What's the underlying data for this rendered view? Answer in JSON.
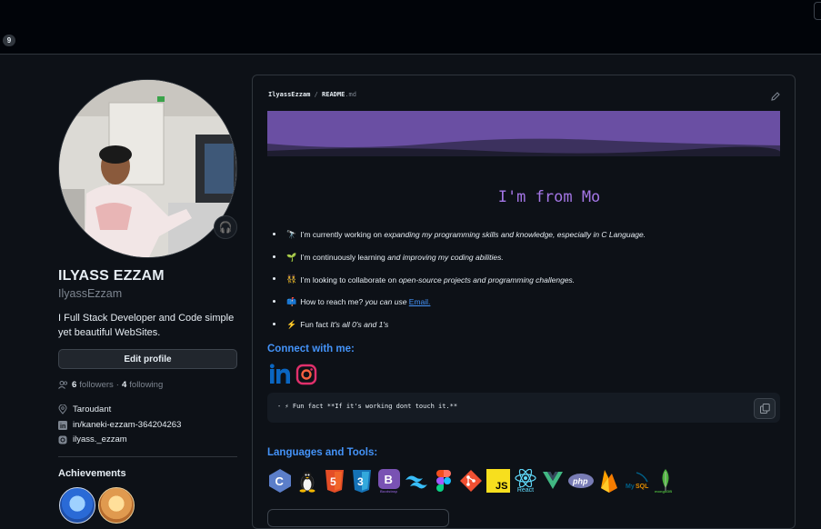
{
  "header": {
    "notification_count": "9"
  },
  "profile": {
    "status_emoji": "🎧",
    "name": "ILYASS EZZAM",
    "login": "IlyassEzzam",
    "bio": "I Full Stack Developer and Code simple yet beautiful WebSites.",
    "edit_button": "Edit profile",
    "followers_count": "6",
    "followers_label": "followers",
    "separator": "·",
    "following_count": "4",
    "following_label": "following",
    "location": "Taroudant",
    "linkedin": "in/kaneki-ezzam-364204263",
    "instagram": "ilyass._ezzam",
    "achievements_title": "Achievements"
  },
  "readme": {
    "owner": "IlyassEzzam",
    "path_sep": " / ",
    "file": "README",
    "ext": ".md",
    "heading": "I'm from Mo",
    "bullets": [
      {
        "emoji": "🔭",
        "plain": "I’m currently working on ",
        "italic": "expanding my programming skills and knowledge, especially in C Language."
      },
      {
        "emoji": "🌱",
        "plain": "I’m continuously learning ",
        "italic": "and improving my coding abilities."
      },
      {
        "emoji": "👯",
        "plain": "I’m looking to collaborate on ",
        "italic": "open-source projects and programming challenges."
      },
      {
        "emoji": "📫",
        "plain": "How to reach me? ",
        "italic": "you can use ",
        "link": "Email."
      },
      {
        "emoji": "⚡",
        "plain": "Fun fact ",
        "italic": "It's all 0's and 1's"
      }
    ],
    "connect_title": "Connect with me:",
    "code_line": "- ⚡ Fun fact **If it's working dont touch it.**",
    "languages_title": "Languages and Tools:",
    "tools": [
      {
        "name": "c",
        "label": "C",
        "color": "#5b7ec9"
      },
      {
        "name": "linux",
        "label": "🐧",
        "color": "#0d1117"
      },
      {
        "name": "html5",
        "label": "5",
        "color": "#e44d26"
      },
      {
        "name": "css3",
        "label": "3",
        "color": "#2965f1"
      },
      {
        "name": "bootstrap",
        "label": "B",
        "color": "#7952b3"
      },
      {
        "name": "tailwind",
        "label": "≈",
        "color": "#0d1117"
      },
      {
        "name": "figma",
        "label": "✦",
        "color": "#0d1117"
      },
      {
        "name": "git",
        "label": "◆",
        "color": "#f05032"
      },
      {
        "name": "javascript",
        "label": "JS",
        "color": "#f7df1e"
      },
      {
        "name": "react",
        "label": "⚛",
        "color": "#0d1117"
      },
      {
        "name": "vue",
        "label": "V",
        "color": "#0d1117"
      },
      {
        "name": "php",
        "label": "php",
        "color": "#0d1117"
      },
      {
        "name": "firebase",
        "label": "▲",
        "color": "#0d1117"
      },
      {
        "name": "mysql",
        "label": "MySQL",
        "color": "#0d1117"
      },
      {
        "name": "mongodb",
        "label": "🍃",
        "color": "#0d1117"
      }
    ],
    "react_label": "React"
  }
}
